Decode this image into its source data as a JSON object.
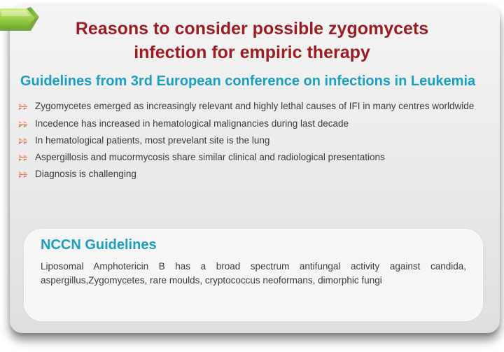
{
  "slide": {
    "title_line1": "Reasons to consider possible zygomycets",
    "title_line2": "infection for empiric therapy",
    "subtitle": "Guidelines from 3rd European conference on infections in Leukemia",
    "bullets": [
      "Zygomycetes emerged as increasingly relevant and highly lethal causes of IFI in many centres worldwide",
      "Incedence has increased in hematological malignancies during last decade",
      "In hematological patients, most prevelant site is the lung",
      "Aspergillosis and mucormycosis share similar clinical and radiological presentations",
      "Diagnosis is challenging"
    ]
  },
  "nccn": {
    "title": "NCCN Guidelines",
    "text": "Liposomal Amphotericin B has a broad spectrum antifungal activity against candida, aspergillus,Zygomycetes, rare moulds, cryptococcus neoformans, dimorphic fungi"
  },
  "colors": {
    "title": "#9b1c24",
    "accent": "#1a9ec2",
    "body_text": "#3a3a3a",
    "bullet": "#e8744a",
    "tab_green": "#8cc63f"
  },
  "icons": {
    "bullet": "bullet-arrows-icon",
    "tab": "green-tab-icon"
  }
}
